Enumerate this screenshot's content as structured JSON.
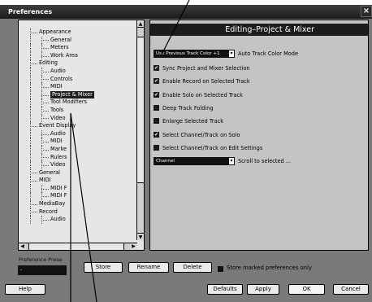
{
  "window": {
    "title": "Preferences",
    "close_glyph": "×"
  },
  "tree": {
    "items": [
      {
        "label": "Appearance",
        "level": 0
      },
      {
        "label": "General",
        "level": 1
      },
      {
        "label": "Meters",
        "level": 1
      },
      {
        "label": "Work Area",
        "level": 1
      },
      {
        "label": "Editing",
        "level": 0
      },
      {
        "label": "Audio",
        "level": 1
      },
      {
        "label": "Controls",
        "level": 1
      },
      {
        "label": "MIDI",
        "level": 1
      },
      {
        "label": "Project & Mixer",
        "level": 1,
        "selected": true
      },
      {
        "label": "Tool Modifiers",
        "level": 1
      },
      {
        "label": "Tools",
        "level": 1
      },
      {
        "label": "Video",
        "level": 1
      },
      {
        "label": "Event Display",
        "level": 0
      },
      {
        "label": "Audio",
        "level": 1
      },
      {
        "label": "MIDI",
        "level": 1
      },
      {
        "label": "Marke",
        "level": 1
      },
      {
        "label": "Rulers",
        "level": 1
      },
      {
        "label": "Video",
        "level": 1
      },
      {
        "label": "General",
        "level": 0
      },
      {
        "label": "MIDI",
        "level": 0
      },
      {
        "label": "MIDI F",
        "level": 1
      },
      {
        "label": "MIDI F",
        "level": 1
      },
      {
        "label": "MediaBay",
        "level": 0
      },
      {
        "label": "Record",
        "level": 0
      },
      {
        "label": "Audio",
        "level": 1
      }
    ]
  },
  "panel": {
    "title": "Editing–Project & Mixer",
    "color_mode": {
      "value": "Use Previous Track Color +1",
      "label": "Auto Track Color Mode"
    },
    "options": [
      {
        "label": "Sync Project and Mixer Selection",
        "checked": true
      },
      {
        "label": "Enable Record on Selected Track",
        "checked": true
      },
      {
        "label": "Enable Solo on Selected Track",
        "checked": true
      },
      {
        "label": "Deep Track Folding",
        "checked": false
      },
      {
        "label": "Enlarge Selected Track",
        "checked": false
      },
      {
        "label": "Select Channel/Track on Solo",
        "checked": true
      },
      {
        "label": "Select Channel/Track on Edit Settings",
        "checked": false
      }
    ],
    "scroll": {
      "value": "Channel",
      "label": "Scroll to selected ..."
    }
  },
  "presets": {
    "label": "Preference Prese",
    "value": "-",
    "store": "Store",
    "rename": "Rename",
    "delete": "Delete",
    "store_marked": "Store marked preferences only"
  },
  "footer": {
    "help": "Help",
    "defaults": "Defaults",
    "apply": "Apply",
    "ok": "OK",
    "cancel": "Cancel"
  },
  "check_glyph": "✔"
}
